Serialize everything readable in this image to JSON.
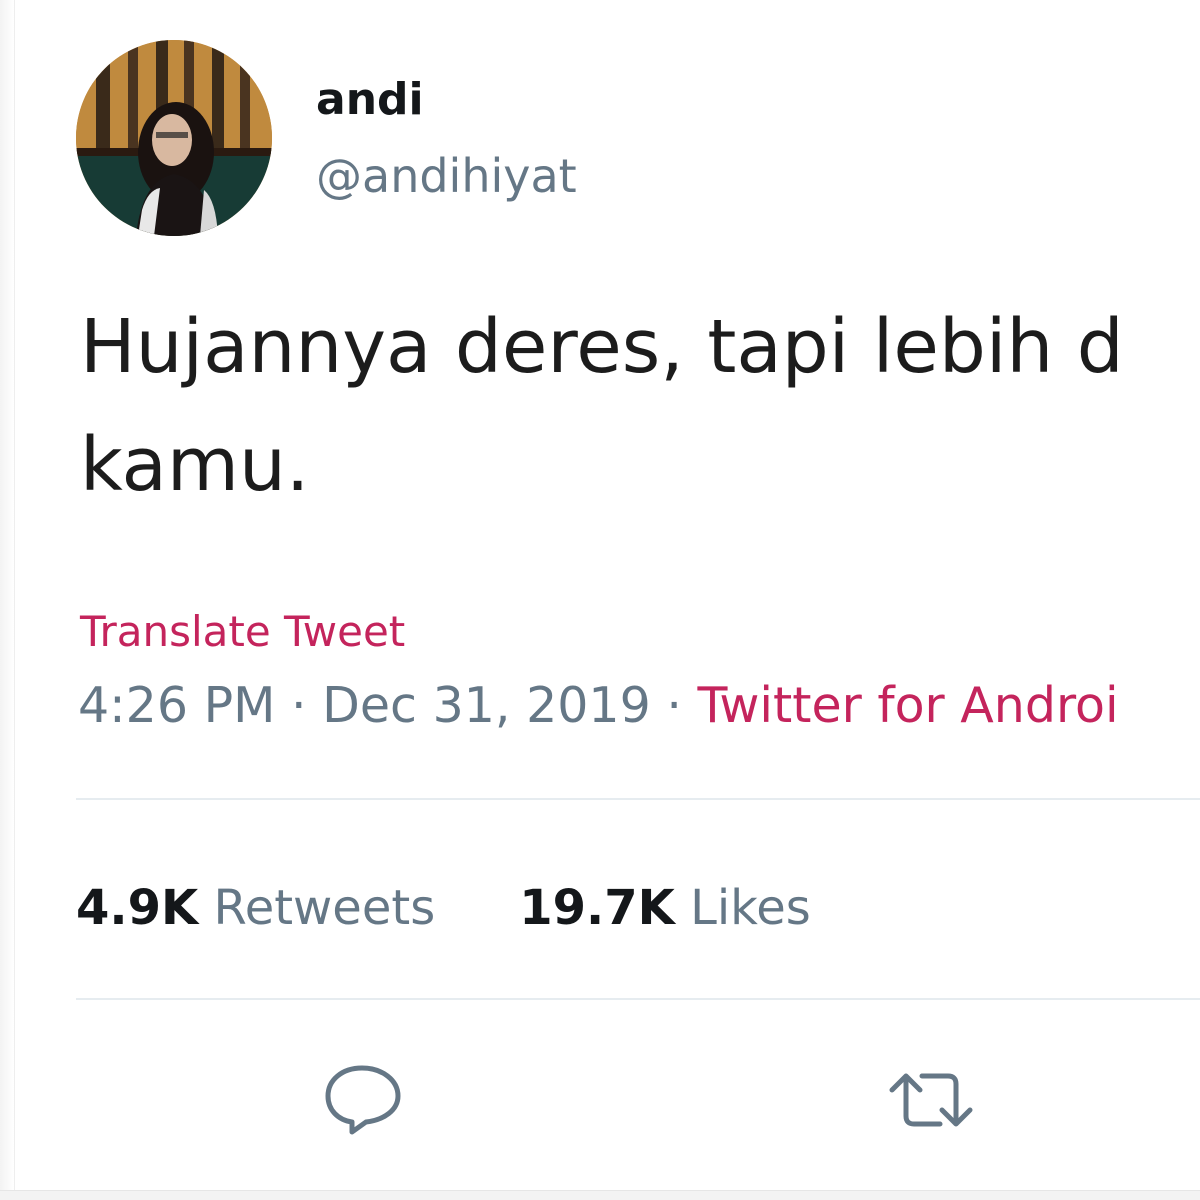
{
  "tweet": {
    "author": {
      "display_name": "andi",
      "handle": "@andihiyat",
      "avatar_icon": "profile-photo"
    },
    "text": "Hujannya deres, tapi lebih d kamu.",
    "text_lines": [
      "Hujannya deres, tapi lebih d",
      "kamu."
    ],
    "translate_label": "Translate Tweet",
    "time": "4:26 PM",
    "separator": " · ",
    "date": "Dec 31, 2019",
    "source": "Twitter for Androi",
    "stats": {
      "retweets_count": "4.9K",
      "retweets_label": "Retweets",
      "likes_count": "19.7K",
      "likes_label": "Likes"
    },
    "actions": {
      "reply_icon": "reply-icon",
      "retweet_icon": "retweet-icon"
    }
  },
  "colors": {
    "link": "#c4245c",
    "secondary_text": "#657786",
    "primary_text": "#14171a",
    "divider": "#e6ecf0",
    "icon": "#657786"
  }
}
